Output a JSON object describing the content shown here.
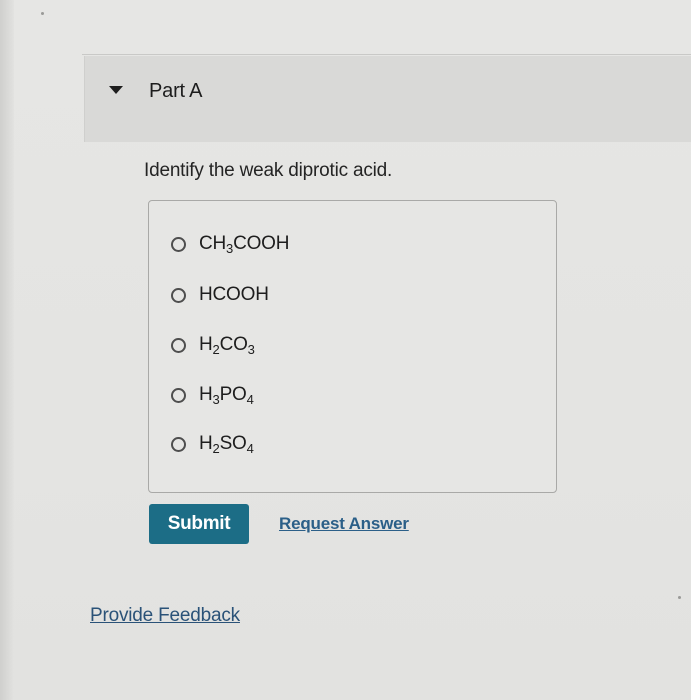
{
  "part": {
    "title": "Part A"
  },
  "question": {
    "text": "Identify the weak diprotic acid."
  },
  "choices": [
    {
      "parts": [
        "CH",
        "3",
        "COOH"
      ]
    },
    {
      "parts": [
        "HCOOH"
      ]
    },
    {
      "parts": [
        "H",
        "2",
        "CO",
        "3"
      ]
    },
    {
      "parts": [
        "H",
        "3",
        "PO",
        "4"
      ]
    },
    {
      "parts": [
        "H",
        "2",
        "SO",
        "4"
      ]
    }
  ],
  "actions": {
    "submit_label": "Submit",
    "request_answer_label": "Request Answer"
  },
  "footer": {
    "feedback_label": "Provide Feedback"
  },
  "colors": {
    "submit_bg": "#1c6d86",
    "link": "#2b5f88",
    "header_bg": "#d9d9d7"
  },
  "icons": {
    "collapse": "caret-down-icon",
    "choice": "radio-unchecked-icon"
  }
}
